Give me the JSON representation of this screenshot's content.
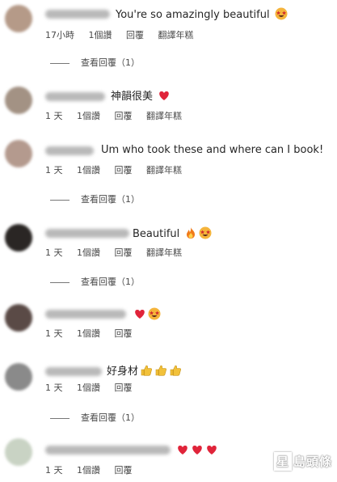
{
  "comments": [
    {
      "text": "You're so amazingly beautiful",
      "emojis": [
        "star-struck"
      ],
      "time": "17小時",
      "likes": "1個讚",
      "reply": "回覆",
      "translate": "翻譯年糕",
      "view_replies": "查看回覆（1）"
    },
    {
      "text": "神韻很美",
      "emojis": [
        "heart"
      ],
      "time": "1 天",
      "likes": "1個讚",
      "reply": "回覆",
      "translate": "翻譯年糕"
    },
    {
      "text": "Um who took these and where can I book!",
      "emojis": [],
      "time": "1 天",
      "likes": "1個讚",
      "reply": "回覆",
      "translate": "翻譯年糕",
      "view_replies": "查看回覆（1）"
    },
    {
      "text": "Beautiful",
      "emojis": [
        "fire",
        "star-struck"
      ],
      "time": "1 天",
      "likes": "1個讚",
      "reply": "回覆",
      "translate": "翻譯年糕",
      "view_replies": "查看回覆（1）"
    },
    {
      "text": "",
      "emojis": [
        "heart",
        "star-struck"
      ],
      "time": "1 天",
      "likes": "1個讚",
      "reply": "回覆"
    },
    {
      "text": "好身材",
      "emojis": [
        "thumbs-up",
        "thumbs-up",
        "thumbs-up"
      ],
      "time": "1 天",
      "likes": "1個讚",
      "reply": "回覆",
      "view_replies": "查看回覆（1）"
    },
    {
      "text": "",
      "emojis": [
        "heart",
        "heart",
        "heart"
      ],
      "time": "1 天",
      "likes": "1個讚",
      "reply": "回覆"
    }
  ],
  "watermark": {
    "text": "星島頭條",
    "box_char": "星"
  },
  "colors": {
    "heart": "#e0243a",
    "star_face": "#f5b43b",
    "fire": "#f07a1a",
    "thumb": "#f2c13a"
  }
}
